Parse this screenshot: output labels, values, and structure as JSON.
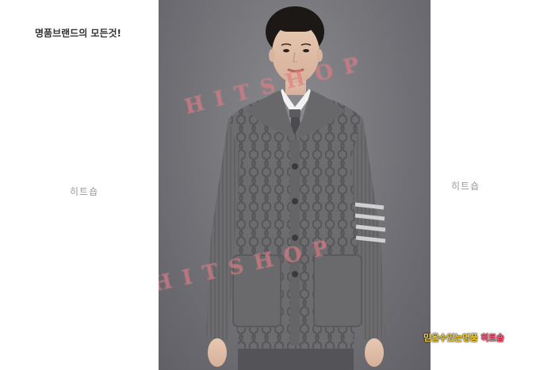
{
  "tagline": "명품브랜드의 모든것!",
  "watermark_left": "히트숍",
  "watermark_right": "히트숍",
  "photo_watermark": "HITSHOP",
  "badge": {
    "part1": "믿을수있는명품",
    "part2": "히트숍"
  },
  "colors": {
    "backdrop": "#727277",
    "cardigan": "#6f6f72",
    "stamp": "#d63c4b",
    "badge_yellow": "#f5d23c",
    "badge_pink": "#ff5a78"
  }
}
